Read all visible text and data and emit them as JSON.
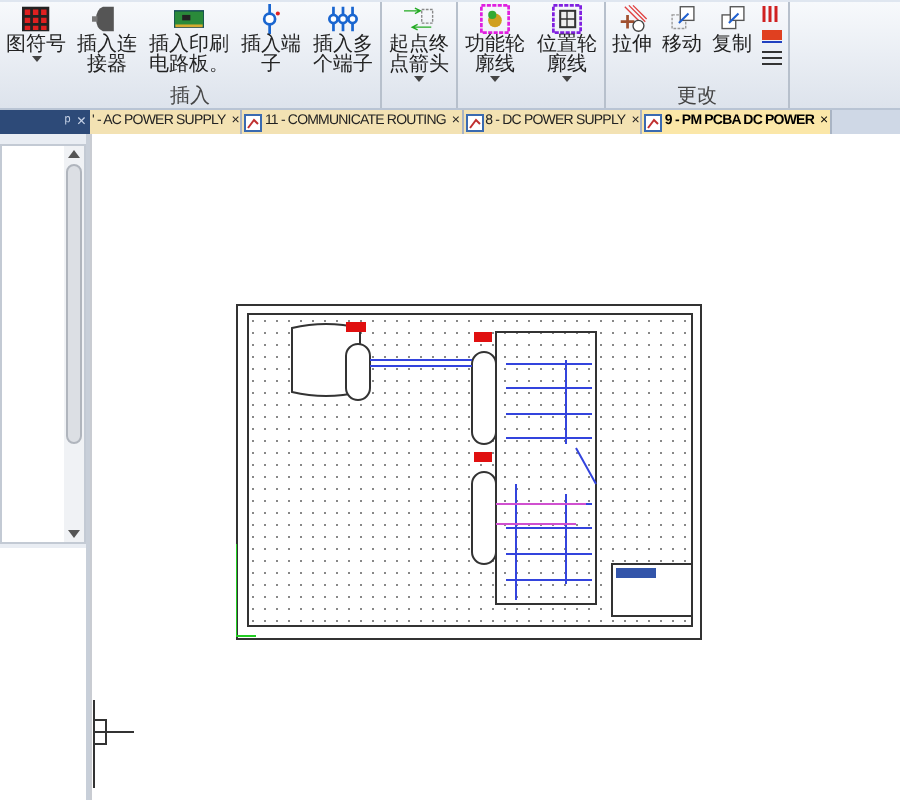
{
  "ribbon": {
    "groups": [
      {
        "label": "插入",
        "buttons": [
          {
            "kind": "grid",
            "label": "图符号",
            "dropdown": true
          },
          {
            "kind": "connector",
            "label": "插入连接器",
            "dropdown": false
          },
          {
            "kind": "pcb",
            "label": "插入印刷电路板。",
            "dropdown": false
          },
          {
            "kind": "terminal",
            "label": "插入端子",
            "dropdown": false
          },
          {
            "kind": "terminals",
            "label": "插入多个端子",
            "dropdown": false
          }
        ]
      },
      {
        "buttons": [
          {
            "kind": "arrows",
            "label": "起点终点箭头",
            "dropdown": true
          }
        ]
      },
      {
        "buttons": [
          {
            "kind": "func",
            "label": "功能轮廓线",
            "dropdown": true
          },
          {
            "kind": "loc",
            "label": "位置轮廓线",
            "dropdown": true
          }
        ]
      },
      {
        "label": "更改",
        "buttons": [
          {
            "kind": "stretch",
            "label": "拉伸",
            "dropdown": false
          },
          {
            "kind": "move",
            "label": "移动",
            "dropdown": false
          },
          {
            "kind": "copy",
            "label": "复制",
            "dropdown": false
          },
          {
            "kind": "small"
          }
        ]
      }
    ]
  },
  "doc_tabs": [
    {
      "label": "' - AC POWER SUPPLY",
      "selected": false,
      "icon": false
    },
    {
      "label": "11 - COMMUNICATE ROUTING",
      "selected": false,
      "icon": true
    },
    {
      "label": "8 - DC POWER SUPPLY",
      "selected": false,
      "icon": true
    },
    {
      "label": "9 - PM PCBA DC POWER",
      "selected": true,
      "icon": true
    }
  ],
  "close_glyph": "×",
  "pin_glyph": "ᵖ"
}
